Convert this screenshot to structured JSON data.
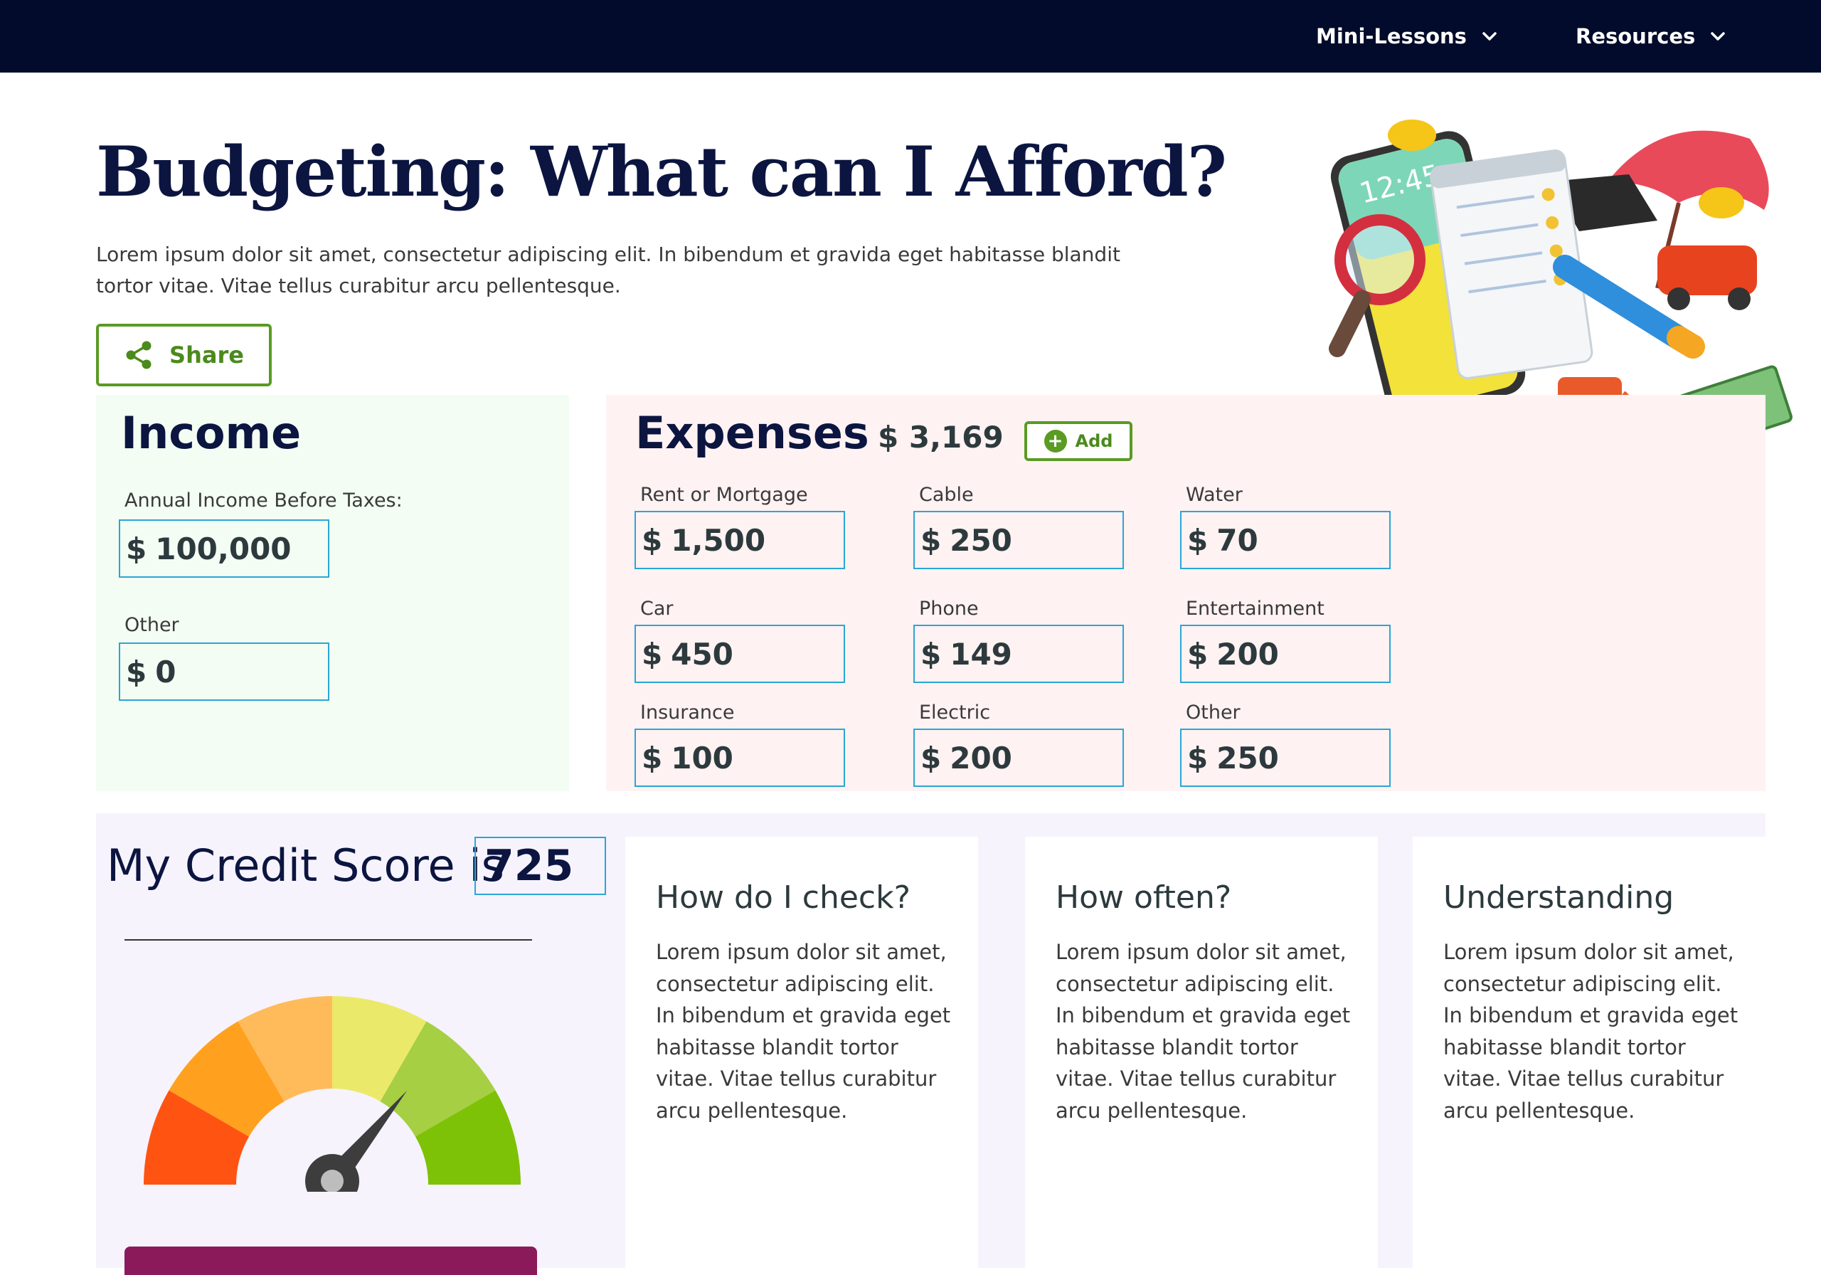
{
  "nav": {
    "items": [
      {
        "label": "Mini-Lessons"
      },
      {
        "label": "Resources"
      }
    ]
  },
  "header": {
    "title": "Budgeting: What can I Afford?",
    "intro": "Lorem ipsum dolor sit amet, consectetur adipiscing elit. In bibendum et gravida eget habitasse blandit tortor vitae. Vitae tellus curabitur arcu pellentesque.",
    "share_label": "Share"
  },
  "hero": {
    "phone_time": "12:45"
  },
  "income": {
    "heading": "Income",
    "currency": "$",
    "fields": [
      {
        "label": "Annual Income Before Taxes:",
        "value": "100,000"
      },
      {
        "label": "Other",
        "value": "0"
      }
    ]
  },
  "expenses": {
    "heading": "Expenses",
    "total": "$ 3,169",
    "add_label": "Add",
    "add_icon": "+",
    "currency": "$",
    "fields": [
      {
        "label": "Rent or Mortgage",
        "value": "1,500"
      },
      {
        "label": "Cable",
        "value": "250"
      },
      {
        "label": "Water",
        "value": "70"
      },
      {
        "label": "Car",
        "value": "450"
      },
      {
        "label": "Phone",
        "value": "149"
      },
      {
        "label": "Entertainment",
        "value": "200"
      },
      {
        "label": "Insurance",
        "value": "100"
      },
      {
        "label": "Electric",
        "value": "200"
      },
      {
        "label": "Other",
        "value": "250"
      }
    ]
  },
  "credit": {
    "label": "My Credit Score is",
    "score": "725",
    "gauge_level": 0.72,
    "gauge_colors": [
      "#ff5411",
      "#ffa11f",
      "#ffbb5a",
      "#ebe96a",
      "#a6cf43",
      "#7dc206"
    ],
    "bottom_button_color": "#8a1a5a"
  },
  "cards": [
    {
      "title": "How do I check?",
      "body": "Lorem ipsum dolor sit amet, consectetur adipiscing elit. In bibendum et gravida eget habitasse blandit tortor vitae. Vitae tellus curabitur arcu pellentesque."
    },
    {
      "title": "How often?",
      "body": "Lorem ipsum dolor sit amet, consectetur adipiscing elit. In bibendum et gravida eget habitasse blandit tortor vitae. Vitae tellus curabitur arcu pellentesque."
    },
    {
      "title": "Understanding",
      "body": "Lorem ipsum dolor sit amet, consectetur adipiscing elit. In bibendum et gravida eget habitasse blandit tortor vitae. Vitae tellus curabitur arcu pellentesque."
    }
  ],
  "colors": {
    "nav_bg": "#020b2b",
    "title": "#0b1540",
    "accent_green": "#5a9b23",
    "field_border": "#2aa6d6",
    "income_bg": "#f3fdf3",
    "expenses_bg": "#fff2f2",
    "credit_bg": "#f6f3fd"
  }
}
